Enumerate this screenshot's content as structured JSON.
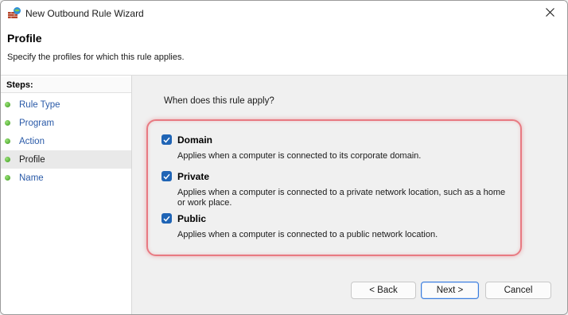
{
  "window": {
    "title": "New Outbound Rule Wizard"
  },
  "header": {
    "title": "Profile",
    "subtitle": "Specify the profiles for which this rule applies."
  },
  "sidebar": {
    "heading": "Steps:",
    "items": [
      {
        "label": "Rule Type"
      },
      {
        "label": "Program"
      },
      {
        "label": "Action"
      },
      {
        "label": "Profile",
        "active": true
      },
      {
        "label": "Name"
      }
    ]
  },
  "main": {
    "question": "When does this rule apply?",
    "options": [
      {
        "label": "Domain",
        "checked": true,
        "description": "Applies when a computer is connected to its corporate domain."
      },
      {
        "label": "Private",
        "checked": true,
        "description": "Applies when a computer is connected to a private network location, such as a home or work place."
      },
      {
        "label": "Public",
        "checked": true,
        "description": "Applies when a computer is connected to a public network location."
      }
    ]
  },
  "buttons": {
    "back": "< Back",
    "next": "Next >",
    "cancel": "Cancel"
  },
  "icons": {
    "app": "firewall-icon",
    "close": "close-icon",
    "step": "green-dot-icon",
    "check": "checkmark-icon"
  },
  "colors": {
    "accent": "#1f64b5",
    "highlight": "#e87a82",
    "step_dot": "#3a9a1a",
    "link": "#2a5aa8"
  }
}
